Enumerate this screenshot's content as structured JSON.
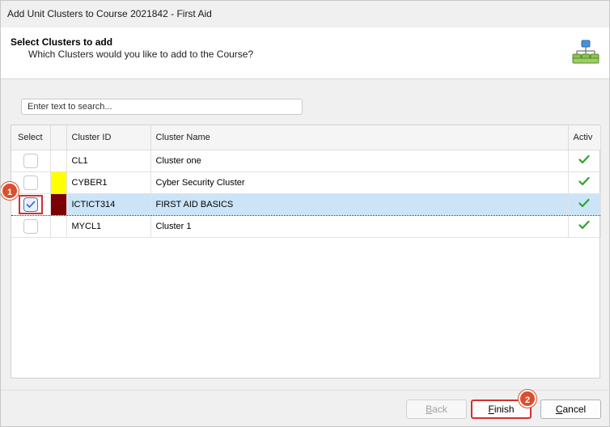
{
  "window": {
    "title": "Add Unit Clusters  to Course 2021842 - First Aid"
  },
  "header": {
    "heading": "Select Clusters to add",
    "subheading": "Which Clusters would you like to add to the Course?",
    "icon": "hierarchy-icon"
  },
  "search": {
    "placeholder": "Enter text to search..."
  },
  "grid": {
    "columns": {
      "select": "Select",
      "color": "",
      "cluster_id": "Cluster ID",
      "cluster_name": "Cluster Name",
      "active": "Activ"
    },
    "rows": [
      {
        "selected": false,
        "color": "",
        "cluster_id": "CL1",
        "cluster_name": "Cluster one",
        "active": true
      },
      {
        "selected": false,
        "color": "#ffff00",
        "cluster_id": "CYBER1",
        "cluster_name": "Cyber Security Cluster",
        "active": true
      },
      {
        "selected": true,
        "color": "#7b0000",
        "cluster_id": "ICTICT314",
        "cluster_name": "FIRST AID BASICS",
        "active": true
      },
      {
        "selected": false,
        "color": "",
        "cluster_id": "MYCL1",
        "cluster_name": "Cluster 1",
        "active": true
      }
    ]
  },
  "markers": {
    "step1": "1",
    "step2": "2"
  },
  "buttons": {
    "back": {
      "first": "B",
      "rest": "ack"
    },
    "finish": {
      "first": "F",
      "rest": "inish"
    },
    "cancel": {
      "first": "C",
      "rest": "ancel"
    }
  },
  "colors": {
    "accent_highlight": "#d32f2f",
    "marker": "#d9502e",
    "selected_row": "#cce4f7",
    "check_green": "#2aa52a"
  }
}
